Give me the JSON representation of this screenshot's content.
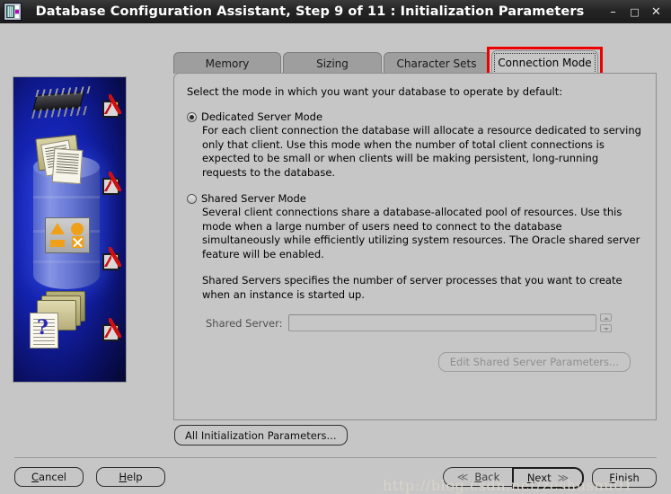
{
  "window": {
    "title": "Database Configuration Assistant, Step 9 of 11 : Initialization Parameters",
    "icon": "database-app-icon",
    "minimize_label": "–",
    "maximize_label": "□",
    "close_label": "✕"
  },
  "tabs": [
    {
      "label": "Memory",
      "active": false
    },
    {
      "label": "Sizing",
      "active": false
    },
    {
      "label": "Character Sets",
      "active": false
    },
    {
      "label": "Connection Mode",
      "active": true
    }
  ],
  "annotation": {
    "color": "#ee0000",
    "target": "Connection Mode"
  },
  "panel": {
    "lead": "Select the mode in which you want your database to operate by default:",
    "options": [
      {
        "label": "Dedicated Server Mode",
        "selected": true,
        "description": "For each client connection the database will allocate a resource dedicated to serving only that client.  Use this mode when the number of total client connections is expected to be small or when clients will be making persistent, long-running requests to the database."
      },
      {
        "label": "Shared Server Mode",
        "selected": false,
        "description": "Several client connections share a database-allocated pool of resources.  Use this mode when a large number of users need to connect to the database simultaneously while efficiently utilizing system resources.  The Oracle shared server feature will be enabled."
      }
    ],
    "note": "Shared Servers specifies the number of server processes that you want to create when an instance is started up.",
    "shared_server": {
      "label": "Shared Server:",
      "value": "",
      "placeholder": "",
      "enabled": false,
      "spinner_up": "spinner-up-icon",
      "spinner_down": "spinner-down-icon"
    },
    "edit_button": {
      "label": "Edit Shared Server Parameters...",
      "enabled": false
    }
  },
  "all_params_button": {
    "label": "All Initialization Parameters..."
  },
  "footer": {
    "cancel": "Cancel",
    "help": "Help",
    "back": "Back",
    "next": "Next",
    "finish": "Finish",
    "back_arrow": "≪",
    "next_arrow": "≫"
  },
  "watermark": "http://blog.csdn.net/zeshusnu01",
  "colors": {
    "titlebar": "#1f1f1f",
    "face": "#c6c6c6",
    "tab_inactive": "#9e9e9e",
    "annotation": "#ee0000",
    "sidebar_blue": "#1220a8"
  }
}
